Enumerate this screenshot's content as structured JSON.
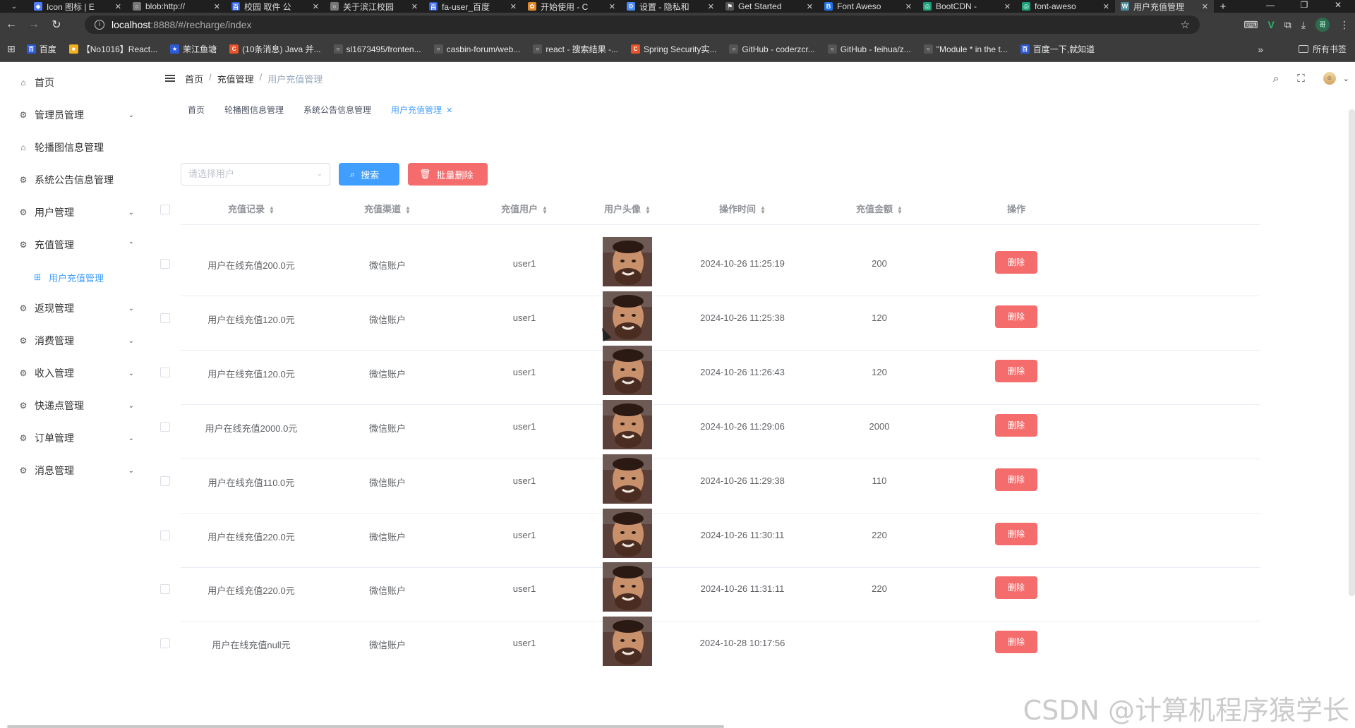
{
  "browser": {
    "tabs": [
      {
        "title": "Icon 图标 | E",
        "color": "#4f7cff",
        "letter": "◆"
      },
      {
        "title": "blob:http://",
        "color": "#777777",
        "letter": "○"
      },
      {
        "title": "校园 取件 公",
        "color": "#2d5bd8",
        "letter": "百"
      },
      {
        "title": "关于滨江校园",
        "color": "#777777",
        "letter": "○"
      },
      {
        "title": "fa-user_百度",
        "color": "#2d5bd8",
        "letter": "百"
      },
      {
        "title": "开始使用 - C",
        "color": "#e0892c",
        "letter": "✿"
      },
      {
        "title": "设置 - 隐私和",
        "color": "#4a8af4",
        "letter": "⚙"
      },
      {
        "title": "Get Started",
        "color": "#555555",
        "letter": "⚑"
      },
      {
        "title": "Font Aweso",
        "color": "#1f73e8",
        "letter": "B"
      },
      {
        "title": "BootCDN -",
        "color": "#1aa07a",
        "letter": "◎"
      },
      {
        "title": "font-aweso",
        "color": "#1aa07a",
        "letter": "◎"
      },
      {
        "title": "用户充值管理",
        "color": "#4a8a9a",
        "letter": "W"
      }
    ],
    "url_host": "localhost",
    "url_path": ":8888/#/recharge/index",
    "bookmarks": [
      {
        "label": "百度",
        "color": "#2d5bd8",
        "letter": "百"
      },
      {
        "label": "【No1016】React...",
        "color": "#f2b01e",
        "letter": "■"
      },
      {
        "label": "茉江鱼塘",
        "color": "#2d5bd8",
        "letter": "★"
      },
      {
        "label": "(10条消息) Java 并...",
        "color": "#e8542a",
        "letter": "C"
      },
      {
        "label": "sl1673495/fronten...",
        "color": "#555555",
        "letter": "○"
      },
      {
        "label": "casbin-forum/web...",
        "color": "#555555",
        "letter": "○"
      },
      {
        "label": "react - 搜索结果 -...",
        "color": "#555555",
        "letter": "○"
      },
      {
        "label": "Spring Security实...",
        "color": "#e8542a",
        "letter": "C"
      },
      {
        "label": "GitHub - coderzcr...",
        "color": "#555555",
        "letter": "○"
      },
      {
        "label": "GitHub - feihua/z...",
        "color": "#555555",
        "letter": "○"
      },
      {
        "label": "\"Module * in the t...",
        "color": "#555555",
        "letter": "○"
      },
      {
        "label": "百度一下,就知道",
        "color": "#2d5bd8",
        "letter": "百"
      }
    ],
    "all_bookmarks": "所有书签",
    "profile_initial": "哥"
  },
  "sidebar": {
    "items": [
      {
        "label": "首页",
        "icon": "home-icon",
        "expand": ""
      },
      {
        "label": "管理员管理",
        "icon": "gear-icon",
        "expand": "down"
      },
      {
        "label": "轮播图信息管理",
        "icon": "home-icon",
        "expand": ""
      },
      {
        "label": "系统公告信息管理",
        "icon": "gear-icon",
        "expand": ""
      },
      {
        "label": "用户管理",
        "icon": "gear-icon",
        "expand": "down"
      },
      {
        "label": "充值管理",
        "icon": "gear-icon",
        "expand": "up"
      },
      {
        "label": "用户充值管理",
        "icon": "grid-icon",
        "expand": "",
        "sub": true
      },
      {
        "label": "返现管理",
        "icon": "gear-icon",
        "expand": "down"
      },
      {
        "label": "消费管理",
        "icon": "gear-icon",
        "expand": "down"
      },
      {
        "label": "收入管理",
        "icon": "gear-icon",
        "expand": "down"
      },
      {
        "label": "快递点管理",
        "icon": "gear-icon",
        "expand": "down"
      },
      {
        "label": "订单管理",
        "icon": "gear-icon",
        "expand": "down"
      },
      {
        "label": "消息管理",
        "icon": "gear-icon",
        "expand": "down"
      }
    ]
  },
  "breadcrumb": [
    "首页",
    "充值管理",
    "用户充值管理"
  ],
  "tags": [
    "首页",
    "轮播图信息管理",
    "系统公告信息管理",
    "用户充值管理"
  ],
  "toolbar": {
    "select_placeholder": "请选择用户",
    "search_label": "搜索",
    "batch_delete_label": "批量删除"
  },
  "table": {
    "columns": [
      "充值记录",
      "充值渠道",
      "充值用户",
      "用户头像",
      "操作时间",
      "充值金额",
      "操作"
    ],
    "rows": [
      {
        "record": "用户在线充值200.0元",
        "channel": "微信账户",
        "user": "user1",
        "time": "2024-10-26 11:25:19",
        "amount": "200"
      },
      {
        "record": "用户在线充值120.0元",
        "channel": "微信账户",
        "user": "user1",
        "time": "2024-10-26 11:25:38",
        "amount": "120"
      },
      {
        "record": "用户在线充值120.0元",
        "channel": "微信账户",
        "user": "user1",
        "time": "2024-10-26 11:26:43",
        "amount": "120"
      },
      {
        "record": "用户在线充值2000.0元",
        "channel": "微信账户",
        "user": "user1",
        "time": "2024-10-26 11:29:06",
        "amount": "2000"
      },
      {
        "record": "用户在线充值110.0元",
        "channel": "微信账户",
        "user": "user1",
        "time": "2024-10-26 11:29:38",
        "amount": "110"
      },
      {
        "record": "用户在线充值220.0元",
        "channel": "微信账户",
        "user": "user1",
        "time": "2024-10-26 11:30:11",
        "amount": "220"
      },
      {
        "record": "用户在线充值220.0元",
        "channel": "微信账户",
        "user": "user1",
        "time": "2024-10-26 11:31:11",
        "amount": "220"
      },
      {
        "record": "用户在线充值null元",
        "channel": "微信账户",
        "user": "user1",
        "time": "2024-10-28 10:17:56",
        "amount": ""
      }
    ],
    "delete_label": "删除"
  },
  "watermark": "CSDN @计算机程序猿学长",
  "colors": {
    "primary": "#409eff",
    "danger": "#f56c6c"
  }
}
